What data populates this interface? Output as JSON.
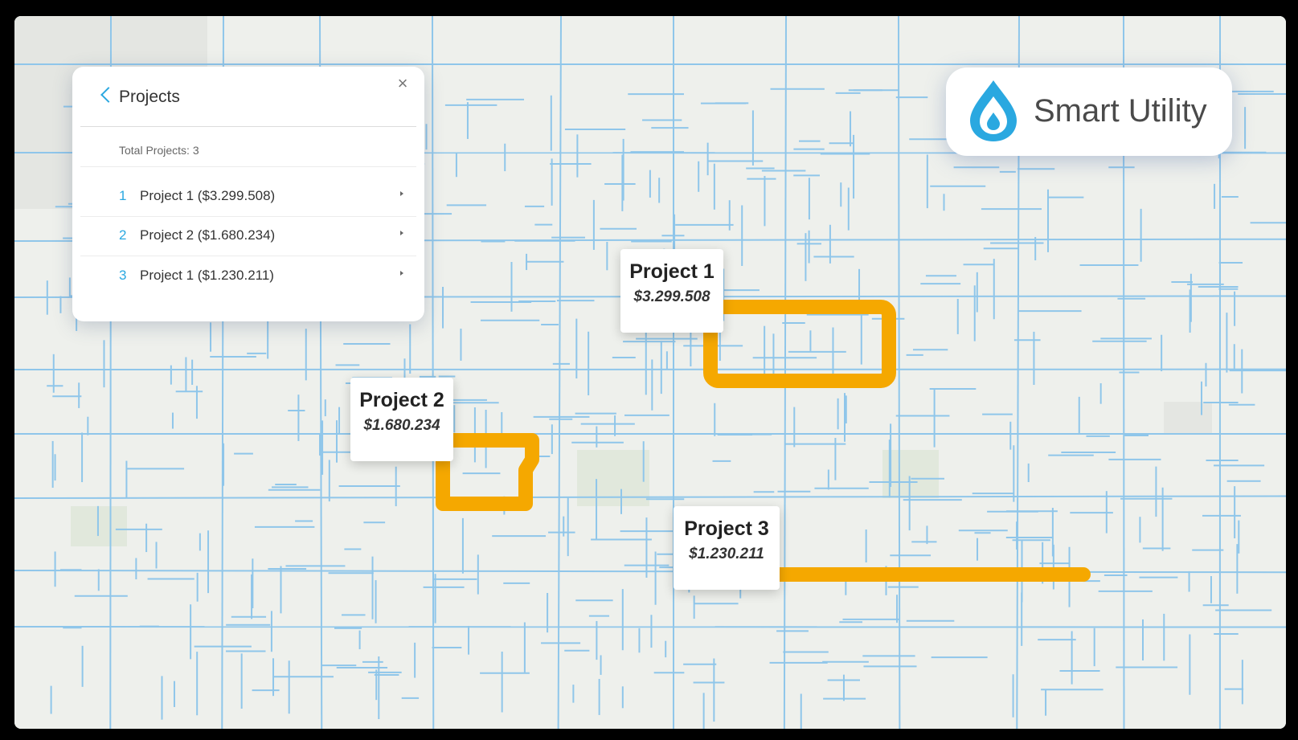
{
  "brand": {
    "name": "Smart Utility",
    "color": "#2aa8e0"
  },
  "panel": {
    "title": "Projects",
    "total_label": "Total Projects: 3",
    "projects": [
      {
        "number": "1",
        "label": "Project 1 ($3.299.508)"
      },
      {
        "number": "2",
        "label": "Project 2 ($1.680.234)"
      },
      {
        "number": "3",
        "label": "Project 1 ($1.230.211)"
      }
    ]
  },
  "callouts": [
    {
      "name": "Project 1",
      "cost": "$3.299.508"
    },
    {
      "name": "Project 2",
      "cost": "$1.680.234"
    },
    {
      "name": "Project 3",
      "cost": "$1.230.211"
    }
  ],
  "colors": {
    "pipe": "#8fc6ea",
    "highlight": "#f5a800",
    "accent": "#2aa8e0"
  }
}
